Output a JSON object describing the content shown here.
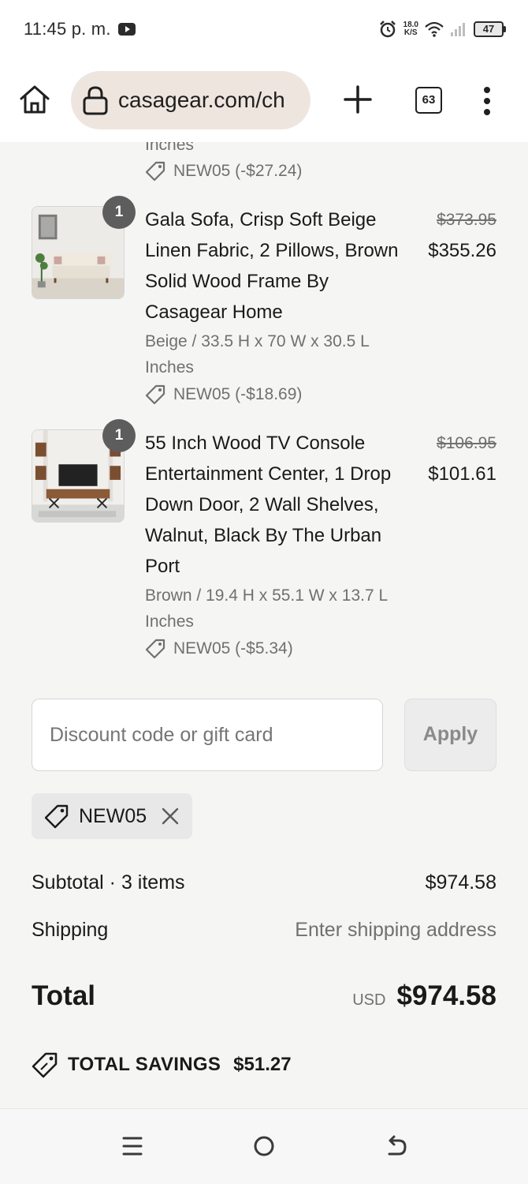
{
  "status_bar": {
    "time": "11:45 p. m.",
    "net_speed_value": "18.0",
    "net_speed_unit": "K/S",
    "battery": "47"
  },
  "browser": {
    "url": "casagear.com/ch",
    "tab_count": "63"
  },
  "previous_item_fragment": {
    "variant_tail": "Inches",
    "discount": "NEW05 (-$27.24)"
  },
  "items": [
    {
      "quantity": "1",
      "title": "Gala Sofa, Crisp Soft Beige Linen Fabric, 2 Pillows, Brown Solid Wood Frame By Casagear Home",
      "variant": "Beige / 33.5 H x 70 W x 30.5 L Inches",
      "discount": "NEW05 (-$18.69)",
      "original_price": "$373.95",
      "price": "$355.26"
    },
    {
      "quantity": "1",
      "title": "55 Inch Wood TV Console Entertainment Center, 1 Drop Down Door, 2 Wall Shelves, Walnut, Black By The Urban Port",
      "variant": "Brown / 19.4 H x 55.1 W x 13.7 L Inches",
      "discount": "NEW05 (-$5.34)",
      "original_price": "$106.95",
      "price": "$101.61"
    }
  ],
  "discount_form": {
    "placeholder": "Discount code or gift card",
    "apply_label": "Apply"
  },
  "applied_code": "NEW05",
  "summary": {
    "subtotal_label": "Subtotal · 3 items",
    "subtotal_value": "$974.58",
    "shipping_label": "Shipping",
    "shipping_value": "Enter shipping address",
    "total_label": "Total",
    "currency": "USD",
    "total_value": "$974.58",
    "savings_label": "TOTAL SAVINGS",
    "savings_value": "$51.27"
  },
  "icons": [
    "youtube-icon",
    "alarm-icon",
    "wifi-icon",
    "signal-icon",
    "battery-icon",
    "home-icon",
    "lock-icon",
    "plus-icon",
    "tabs-icon",
    "more-icon",
    "tag-icon",
    "close-icon",
    "savings-tag-icon",
    "recents-icon",
    "home-nav-icon",
    "back-icon"
  ],
  "colors": {
    "page_background": "#f5f5f4",
    "url_pill": "#efe5df",
    "muted_text": "#707070",
    "badge": "#5d5d5d"
  }
}
